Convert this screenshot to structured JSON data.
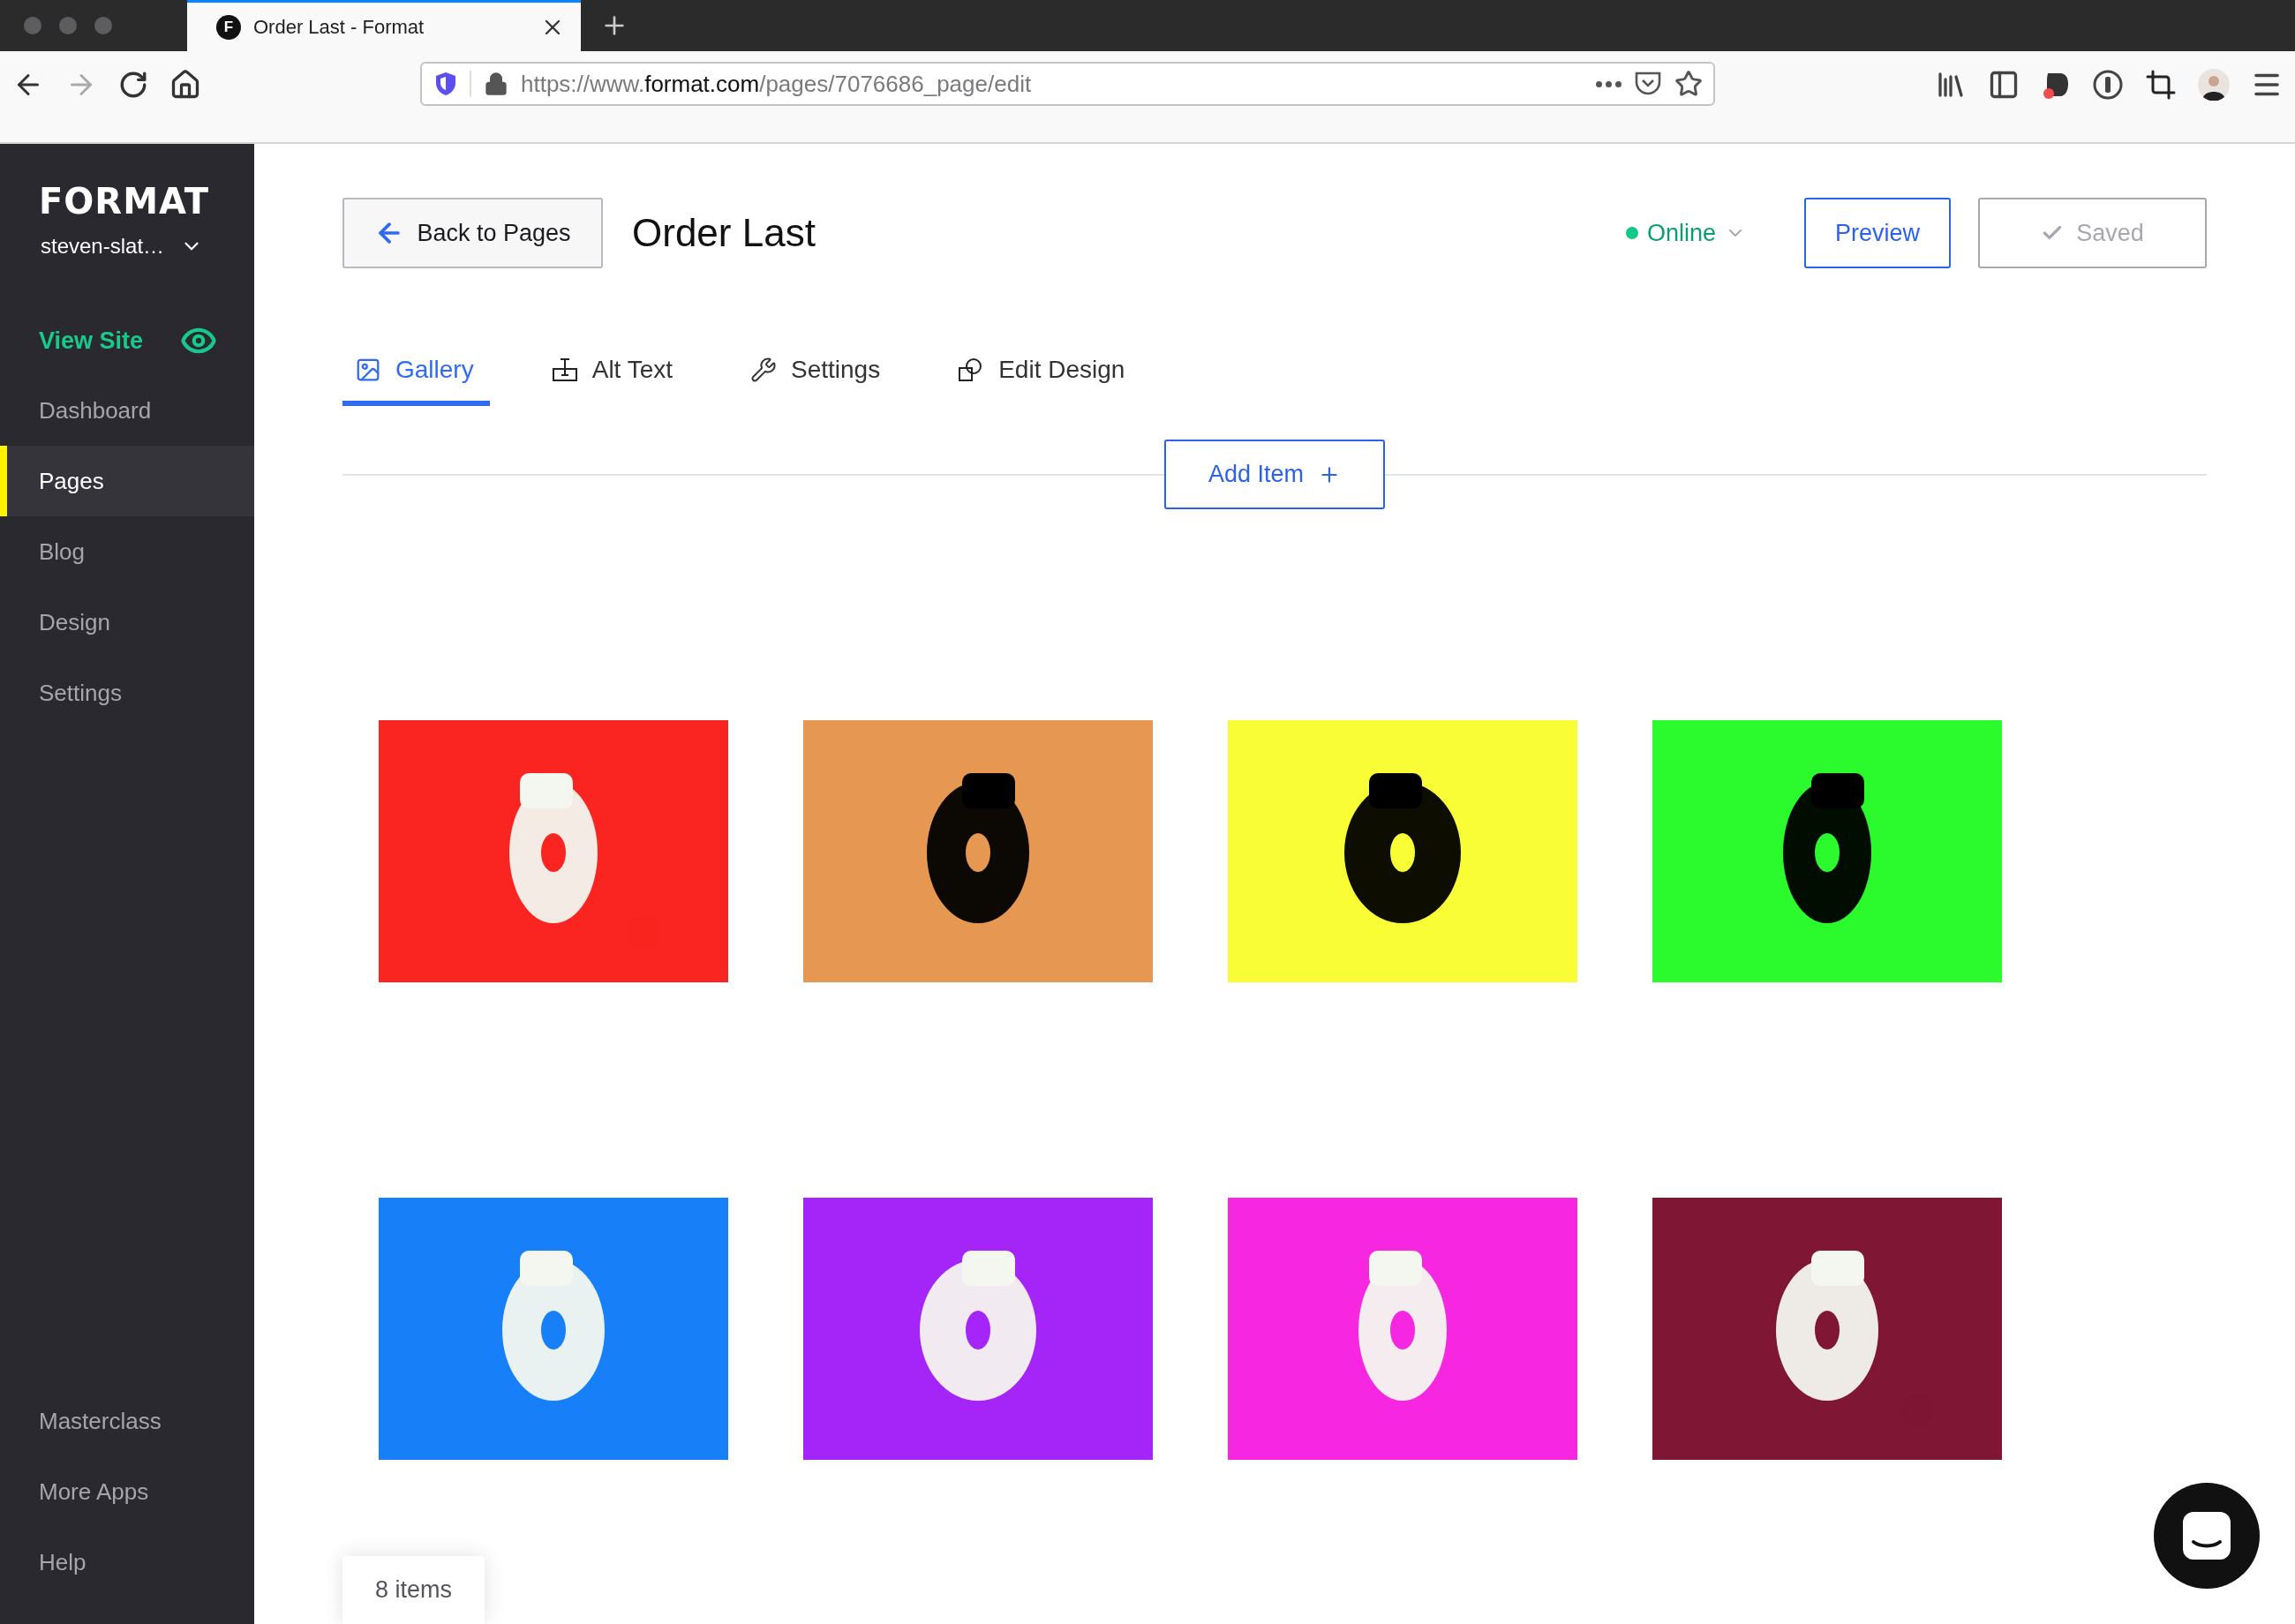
{
  "browser": {
    "favicon": "F",
    "tab_title": "Order Last - Format",
    "url_parts": [
      "https://www.",
      "format.com",
      "/pages/7076686_page/edit"
    ]
  },
  "sidebar": {
    "logo": "FORMAT",
    "account": "steven-slat…",
    "view_site": "View Site",
    "items": [
      {
        "label": "Dashboard",
        "selected": false
      },
      {
        "label": "Pages",
        "selected": true
      },
      {
        "label": "Blog",
        "selected": false
      },
      {
        "label": "Design",
        "selected": false
      },
      {
        "label": "Settings",
        "selected": false
      }
    ],
    "bottom_items": [
      "Masterclass",
      "More Apps",
      "Help"
    ]
  },
  "header": {
    "back_button": "Back to Pages",
    "title": "Order Last",
    "status": {
      "label": "Online",
      "color": "#12c98a"
    },
    "preview_button": "Preview",
    "saved_button": {
      "label": "Saved",
      "disabled": true
    }
  },
  "tabs": [
    {
      "kind": "gallery",
      "label": "Gallery",
      "selected": true
    },
    {
      "kind": "alt",
      "label": "Alt Text",
      "selected": false
    },
    {
      "kind": "settings",
      "label": "Settings",
      "selected": false
    },
    {
      "kind": "design",
      "label": "Edit Design",
      "selected": false
    }
  ],
  "add_item_button": "Add Item",
  "item_count": "8 items"
}
